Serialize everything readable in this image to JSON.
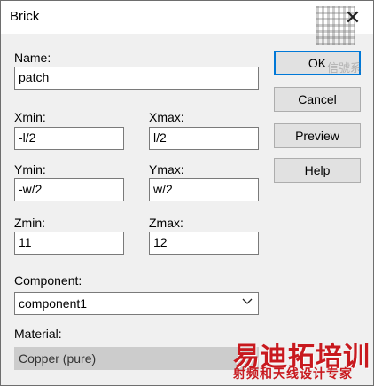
{
  "window": {
    "title": "Brick"
  },
  "fields": {
    "name": {
      "label": "Name:",
      "value": "patch"
    },
    "xmin": {
      "label": "Xmin:",
      "value": "-l/2"
    },
    "xmax": {
      "label": "Xmax:",
      "value": "l/2"
    },
    "ymin": {
      "label": "Ymin:",
      "value": "-w/2"
    },
    "ymax": {
      "label": "Ymax:",
      "value": "w/2"
    },
    "zmin": {
      "label": "Zmin:",
      "value": "11"
    },
    "zmax": {
      "label": "Zmax:",
      "value": "12"
    },
    "component": {
      "label": "Component:",
      "value": "component1"
    },
    "material": {
      "label": "Material:",
      "value": "Copper (pure)"
    }
  },
  "buttons": {
    "ok": "OK",
    "cancel": "Cancel",
    "preview": "Preview",
    "help": "Help"
  },
  "watermark": {
    "ghost": "信號系",
    "logo": "易迪拓培训",
    "subtitle": "射频和天线设计专家"
  },
  "icons": {
    "close": "close-icon",
    "chevron": "chevron-down-icon",
    "qr": "qr-code-icon"
  }
}
